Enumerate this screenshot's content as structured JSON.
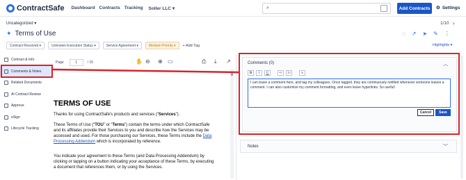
{
  "app": {
    "logo_text": "ContractSafe"
  },
  "nav": {
    "links": [
      "Dashboard",
      "Contracts",
      "Tracking"
    ],
    "org": "Soller LLC",
    "search_placeholder": "",
    "add_button": "Add Contracts",
    "settings_label": "Settings"
  },
  "header": {
    "folder": "Uncategorized",
    "title": "Terms of Use",
    "pager": "1/10"
  },
  "filters": {
    "chips": [
      "Contract Received",
      "Unknown Execution Status",
      "Service Agreement",
      "Medium Priority"
    ],
    "add_tag": "+ Add Tag",
    "highlights": "Highlights"
  },
  "sidebar": {
    "items": [
      {
        "label": "Contract & Info"
      },
      {
        "label": "Comments & Notes"
      },
      {
        "label": "Related Documents"
      },
      {
        "label": "AI Contract Review"
      },
      {
        "label": "Approve"
      },
      {
        "label": "eSign"
      },
      {
        "label": "Lifecycle Tracking"
      }
    ]
  },
  "viewer": {
    "page_label": "Page",
    "page_value": "1",
    "page_total": "/ 15"
  },
  "document": {
    "heading": "TERMS OF USE",
    "p1_a": "Thanks for using ContractSafe's products and services (“",
    "p1_b": "Services",
    "p1_c": "”).",
    "p2_a": "These Terms of Use (“",
    "p2_b": "TOU",
    "p2_c": "” or “",
    "p2_d": "Terms",
    "p2_e": "”) contain the terms under which ContractSafe and its affiliates provide their Services to you and describe how the Services may be accessed and used. For those purchasing our Services, these Terms include the ",
    "p2_link": "Data Processing Addendum",
    "p2_f": " which is incorporated by reference.",
    "p3": "You indicate your agreement to these Terms (and Data Processing Addendum) by clicking or tapping on a button indicating your acceptance of these Terms, by executing a document that references them, or by using the Services."
  },
  "comments": {
    "title": "Comments (0)",
    "toolbar": [
      "B",
      "I",
      "U",
      "•≡",
      "1≡",
      "∞"
    ],
    "text": "I can leave a comment here, and tag my colleagues. Once tagged, they are continuously notified whenever someone leaves a comment. I can also customize my comment formatting, and even leave hyperlinks. So useful!",
    "cancel": "Cancel",
    "save": "Save"
  },
  "notes": {
    "title": "Notes"
  },
  "colors": {
    "accent": "#1a56c7",
    "annotation": "#d8232a",
    "priority": "#c27a14"
  }
}
